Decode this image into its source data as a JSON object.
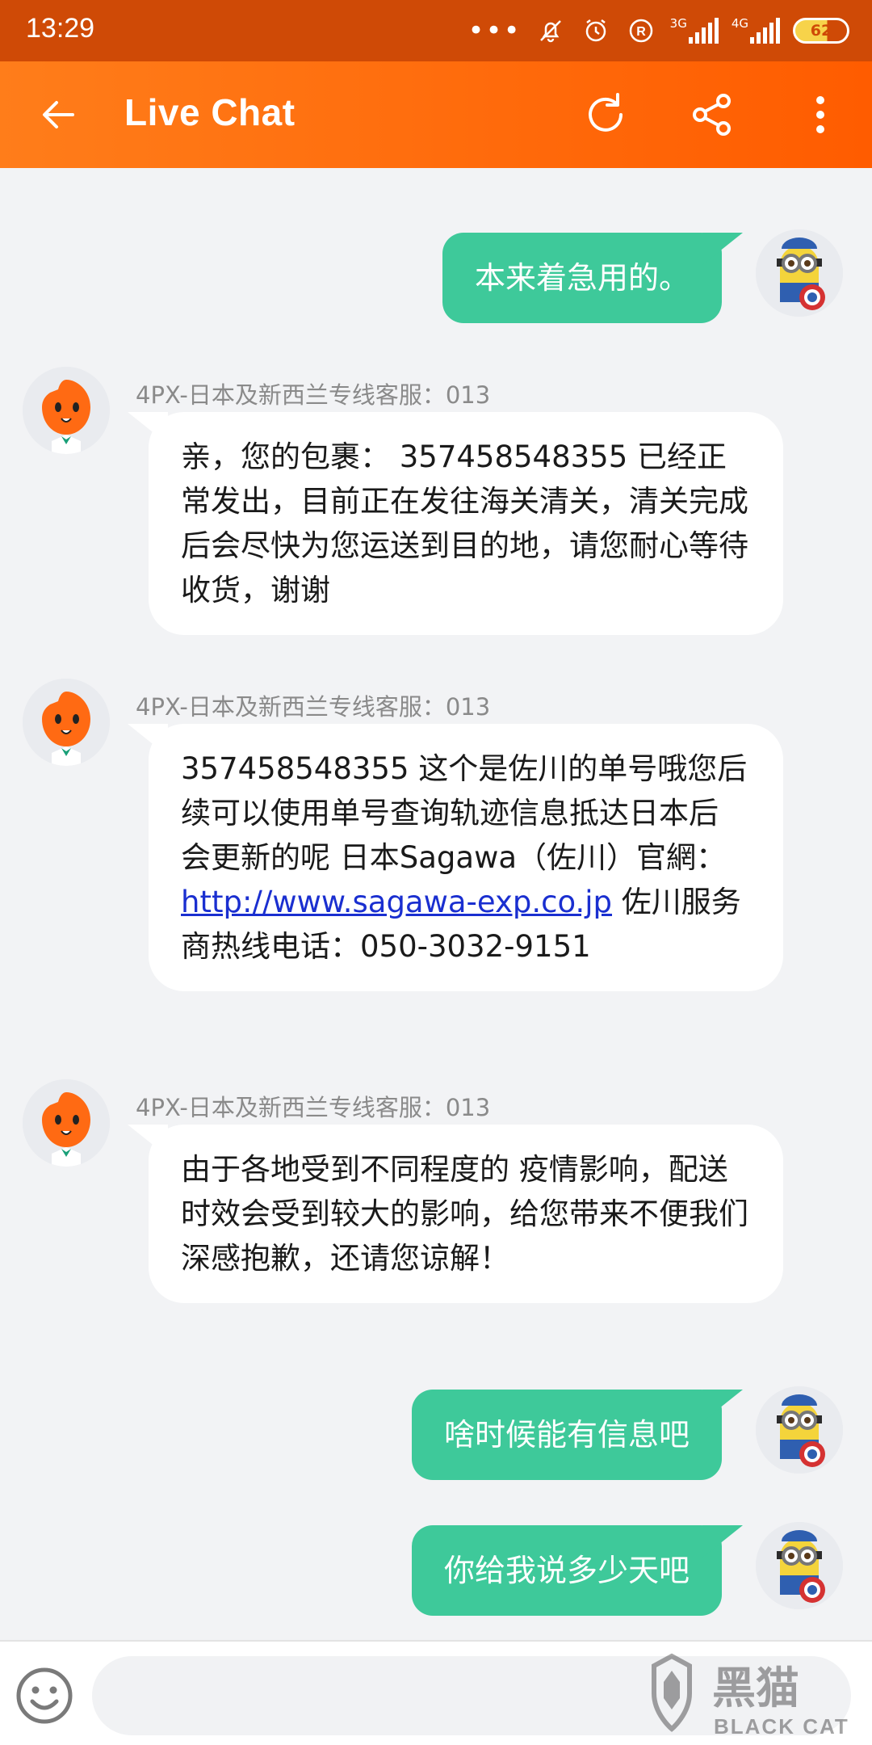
{
  "status_bar": {
    "time": "13:29",
    "signal_1_label": "3G",
    "signal_2_label": "4G",
    "battery": "62"
  },
  "header": {
    "title": "Live Chat"
  },
  "messages": [
    {
      "type": "out",
      "text": "本来着急用的。"
    },
    {
      "type": "in",
      "agent": "4PX-日本及新西兰专线客服：013",
      "text": "亲，您的包裹： 357458548355 已经正常发出，目前正在发往海关清关，清关完成后会尽快为您运送到目的地，请您耐心等待收货，谢谢"
    },
    {
      "type": "in",
      "agent": "4PX-日本及新西兰专线客服：013",
      "text_before": "357458548355 这个是佐川的单号哦您后续可以使用单号查询轨迹信息抵达日本后 会更新的呢 日本Sagawa（佐川）官網：",
      "link": "http://www.sagawa-exp.co.jp",
      "text_after": " 佐川服务商热线电话：050-3032-9151"
    },
    {
      "type": "in",
      "agent": "4PX-日本及新西兰专线客服：013",
      "text": "由于各地受到不同程度的 疫情影响，配送时效会受到较大的影响，给您带来不便我们深感抱歉，还请您谅解！"
    },
    {
      "type": "out",
      "text": "啥时候能有信息吧"
    },
    {
      "type": "out",
      "text": "你给我说多少天吧"
    }
  ],
  "colors": {
    "header_start": "#ff7d1a",
    "header_end": "#ff5c00",
    "status_bar": "#cf4a06",
    "outgoing_bubble": "#3ec99a",
    "link": "#1a2fd0"
  },
  "watermark": {
    "text_cn": "黑猫",
    "text_en": "BLACK CAT"
  }
}
